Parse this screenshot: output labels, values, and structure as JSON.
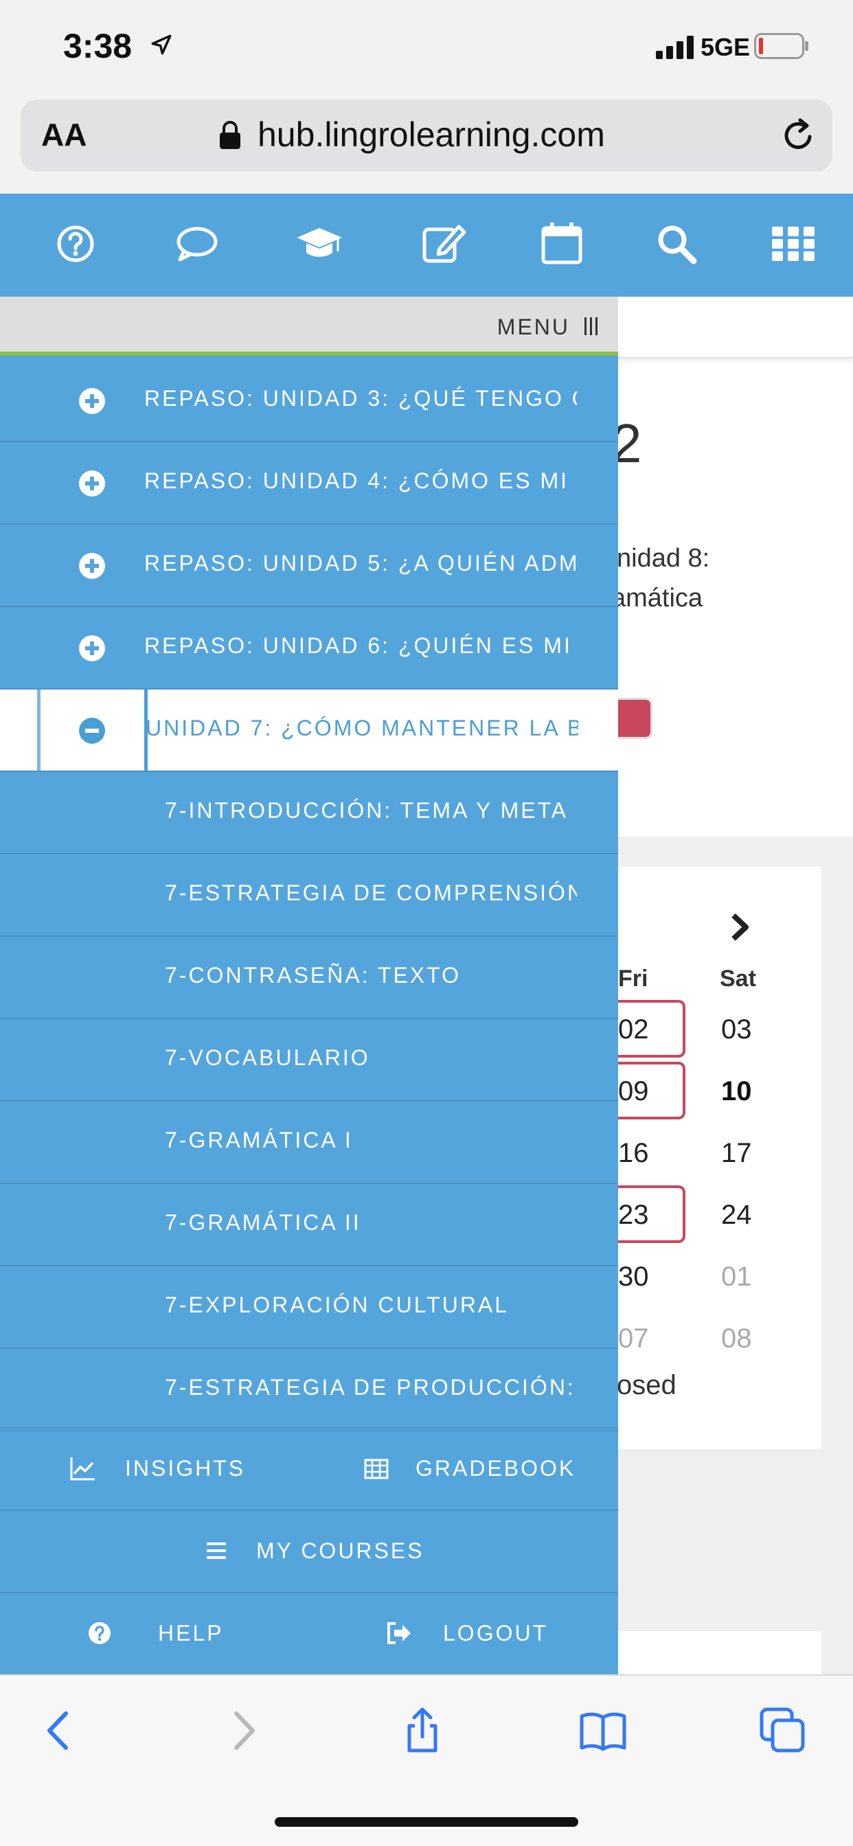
{
  "status": {
    "time": "3:38",
    "network": "5GE"
  },
  "browser": {
    "aa": "AA",
    "url": "hub.lingrolearning.com"
  },
  "toolbar": {
    "icons": [
      "help-circle-icon",
      "chat-bubble-icon",
      "graduation-cap-icon",
      "edit-icon",
      "calendar-icon",
      "search-icon",
      "apps-grid-icon"
    ]
  },
  "menu": {
    "title": "MENU",
    "items": [
      {
        "label": "REPASO: UNIDAD 3: ¿QUÉ TENGO Q…",
        "type": "section",
        "expanded": false
      },
      {
        "label": "REPASO: UNIDAD 4: ¿CÓMO ES MI …",
        "type": "section",
        "expanded": false
      },
      {
        "label": "REPASO: UNIDAD 5: ¿A QUIÉN ADMI…",
        "type": "section",
        "expanded": false
      },
      {
        "label": "REPASO: UNIDAD 6: ¿QUIÉN ES MI F…",
        "type": "section",
        "expanded": false
      },
      {
        "label": "UNIDAD 7: ¿CÓMO MANTENER LA B…",
        "type": "section",
        "expanded": true
      },
      {
        "label": "7-INTRODUCCIÓN: TEMA Y META …",
        "type": "sub"
      },
      {
        "label": "7-ESTRATEGIA DE COMPRENSIÓN…",
        "type": "sub"
      },
      {
        "label": "7-CONTRASEÑA: TEXTO",
        "type": "sub"
      },
      {
        "label": "7-VOCABULARIO",
        "type": "sub"
      },
      {
        "label": "7-GRAMÁTICA I",
        "type": "sub"
      },
      {
        "label": "7-GRAMÁTICA II",
        "type": "sub"
      },
      {
        "label": "7-EXPLORACIÓN CULTURAL",
        "type": "sub"
      },
      {
        "label": "7-ESTRATEGIA DE PRODUCCIÓN: …",
        "type": "sub"
      }
    ],
    "footer": {
      "insights": "INSIGHTS",
      "gradebook": "GRADEBOOK",
      "my_courses": "MY COURSES",
      "help": "HELP",
      "logout": "LOGOUT"
    }
  },
  "background": {
    "big_number": "2",
    "text_line1": "nidad 8:",
    "text_line2": "amática",
    "calendar": {
      "headers": [
        "Fri",
        "Sat"
      ],
      "rows": [
        [
          "02",
          "03"
        ],
        [
          "09",
          "10"
        ],
        [
          "16",
          "17"
        ],
        [
          "23",
          "24"
        ],
        [
          "30",
          "01"
        ],
        [
          "07",
          "08"
        ]
      ],
      "footer": "osed"
    }
  },
  "colors": {
    "primary": "#54a5db",
    "accent_green": "#8cc14c",
    "due_red": "#c8475c",
    "link_blue": "#3478f6"
  }
}
